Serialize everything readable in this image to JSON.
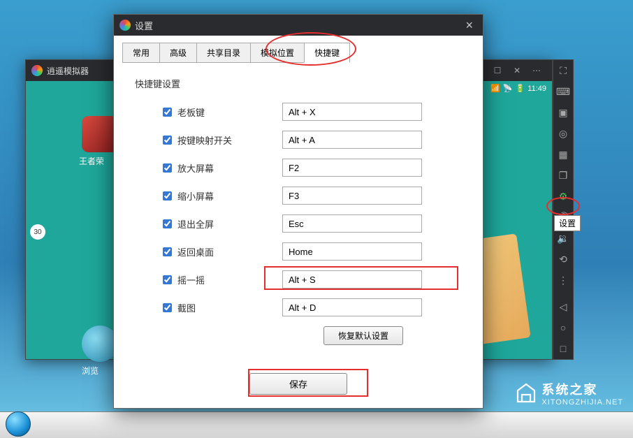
{
  "emulator": {
    "title": "逍遥模拟器",
    "status_time": "11:49",
    "app_icon_label": "王者荣",
    "browser_label": "浏览",
    "level_badge": "30"
  },
  "settings_dialog": {
    "title": "设置",
    "tabs": [
      "常用",
      "高级",
      "共享目录",
      "模拟位置",
      "快捷键"
    ],
    "active_tab": 4,
    "section_title": "快捷键设置",
    "hotkeys": [
      {
        "checked": true,
        "label": "老板键",
        "value": "Alt + X"
      },
      {
        "checked": true,
        "label": "按键映射开关",
        "value": "Alt + A"
      },
      {
        "checked": true,
        "label": "放大屏幕",
        "value": "F2"
      },
      {
        "checked": true,
        "label": "缩小屏幕",
        "value": "F3"
      },
      {
        "checked": true,
        "label": "退出全屏",
        "value": "Esc"
      },
      {
        "checked": true,
        "label": "返回桌面",
        "value": "Home"
      },
      {
        "checked": true,
        "label": "摇一摇",
        "value": "Alt + S"
      },
      {
        "checked": true,
        "label": "截图",
        "value": "Alt + D"
      }
    ],
    "restore_label": "恢复默认设置",
    "save_label": "保存"
  },
  "side_tooltip": "设置",
  "watermark": {
    "title": "系统之家",
    "url": "XITONGZHIJIA.NET"
  }
}
